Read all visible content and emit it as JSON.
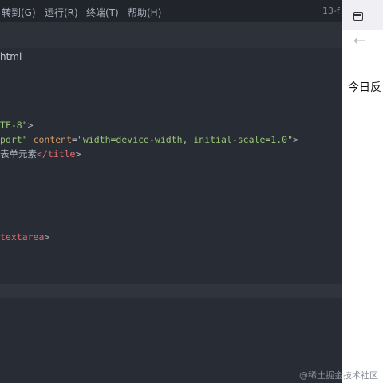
{
  "menu": {
    "goto": "转到(G)",
    "run": "运行(R)",
    "terminal": "终端(T)",
    "help": "帮助(H)"
  },
  "window_title": "13-f",
  "editor": {
    "filename": "html",
    "lines": {
      "meta_charset_val": "TF-8\"",
      "meta_charset_end": ">",
      "meta_viewport_name": "port\"",
      "meta_viewport_attr": "content",
      "meta_viewport_eq": "=",
      "meta_viewport_val": "\"width=device-width, initial-scale=1.0\"",
      "meta_viewport_end": ">",
      "title_text": "表单元素",
      "title_close": "</title",
      "title_end": ">",
      "textarea_close": "textarea",
      "textarea_end": ">"
    }
  },
  "browser": {
    "back_symbol": "←",
    "page_heading": "今日反"
  },
  "watermark": "@稀土掘金技术社区"
}
